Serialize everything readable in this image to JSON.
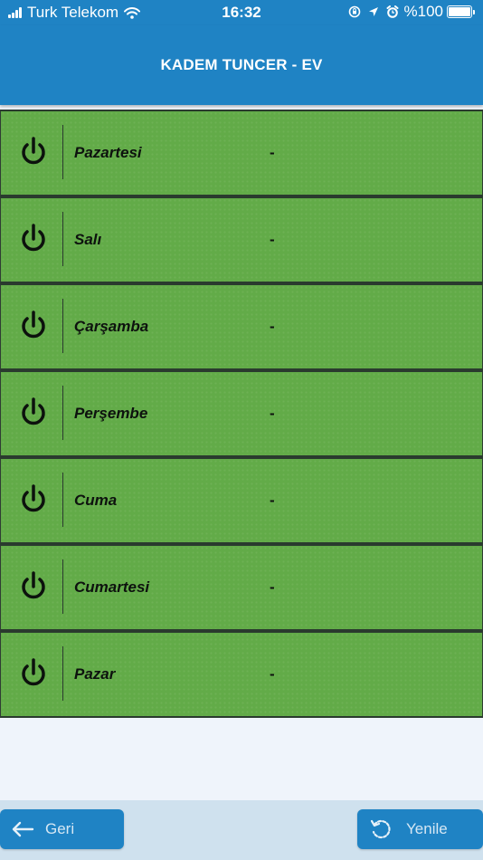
{
  "status_bar": {
    "carrier": "Turk Telekom",
    "time": "16:32",
    "battery_text": "%100"
  },
  "header": {
    "title": "KADEM TUNCER - EV"
  },
  "days": [
    {
      "label": "Pazartesi",
      "value": "-"
    },
    {
      "label": "Salı",
      "value": "-"
    },
    {
      "label": "Çarşamba",
      "value": "-"
    },
    {
      "label": "Perşembe",
      "value": "-"
    },
    {
      "label": "Cuma",
      "value": "-"
    },
    {
      "label": "Cumartesi",
      "value": "-"
    },
    {
      "label": "Pazar",
      "value": "-"
    }
  ],
  "footer": {
    "back_label": "Geri",
    "refresh_label": "Yenile"
  },
  "icons": {
    "row_icon": "power-icon",
    "back_icon": "arrow-left-icon",
    "refresh_icon": "refresh-icon"
  },
  "colors": {
    "primary": "#1f83c4",
    "row_green": "#62ab48",
    "background": "#eff4fb"
  }
}
